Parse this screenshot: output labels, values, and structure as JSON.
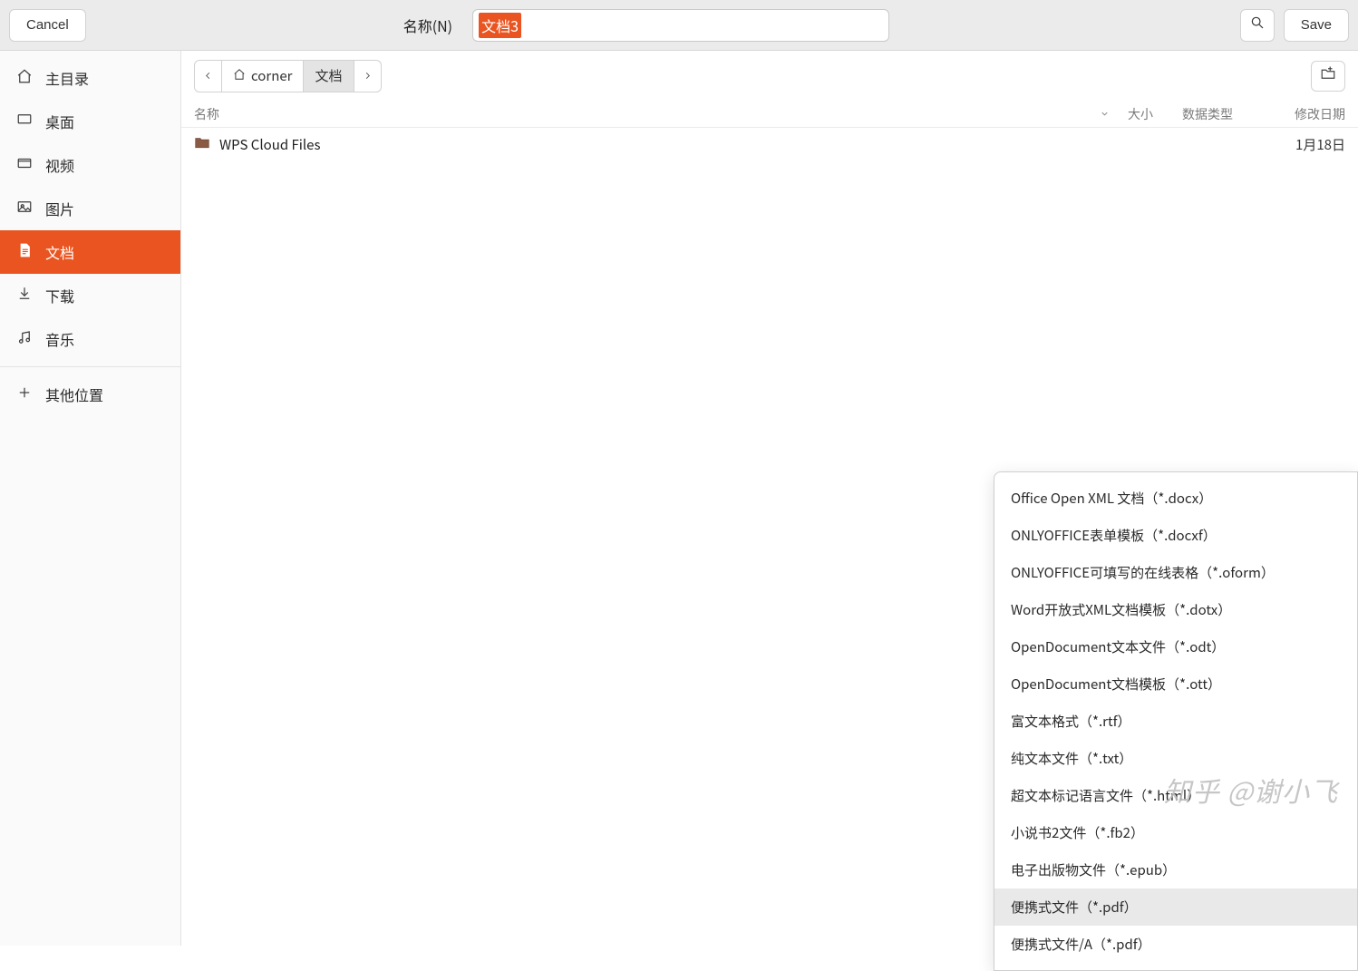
{
  "header": {
    "cancel": "Cancel",
    "name_label": "名称(N)",
    "filename": "文档3",
    "save": "Save"
  },
  "sidebar": {
    "items": [
      {
        "id": "home",
        "label": "主目录",
        "icon": "home-icon",
        "active": false
      },
      {
        "id": "desktop",
        "label": "桌面",
        "icon": "desktop-icon",
        "active": false
      },
      {
        "id": "videos",
        "label": "视频",
        "icon": "video-icon",
        "active": false
      },
      {
        "id": "pictures",
        "label": "图片",
        "icon": "picture-icon",
        "active": false
      },
      {
        "id": "documents",
        "label": "文档",
        "icon": "document-icon",
        "active": true
      },
      {
        "id": "downloads",
        "label": "下载",
        "icon": "download-icon",
        "active": false
      },
      {
        "id": "music",
        "label": "音乐",
        "icon": "music-icon",
        "active": false
      }
    ],
    "other_locations": "其他位置"
  },
  "breadcrumb": {
    "home_name": "corner",
    "current": "文档"
  },
  "columns": {
    "name": "名称",
    "size": "大小",
    "type": "数据类型",
    "date": "修改日期"
  },
  "files": [
    {
      "name": "WPS Cloud Files",
      "date": "1月18日"
    }
  ],
  "type_menu": [
    "Office Open XML 文档（*.docx）",
    "ONLYOFFICE表单模板（*.docxf）",
    "ONLYOFFICE可填写的在线表格（*.oform）",
    "Word开放式XML文档模板（*.dotx）",
    "OpenDocument文本文件（*.odt）",
    "OpenDocument文档模板（*.ott）",
    "富文本格式（*.rtf）",
    "纯文本文件（*.txt）",
    "超文本标记语言文件（*.html）",
    "小说书2文件（*.fb2）",
    "电子出版物文件（*.epub）",
    "便携式文件（*.pdf）",
    "便携式文件/A（*.pdf）"
  ],
  "type_menu_highlight_index": 11,
  "watermark": "知乎 @谢小飞"
}
